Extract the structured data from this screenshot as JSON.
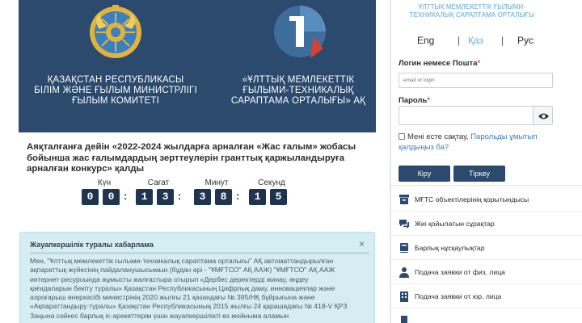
{
  "banner": {
    "org_left": [
      "ҚАЗАҚСТАН РЕСПУБЛИКАСЫ",
      "БІЛІМ ЖӘНЕ ҒЫЛЫМ МИНИСТРЛІГІ",
      "ҒЫЛЫМ КОМИТЕТІ"
    ],
    "org_right": [
      "«ҰЛТТЫҚ МЕМЛЕКЕТТІК",
      "ҒЫЛЫМИ-ТЕХНИКАЛЫҚ",
      "САРАПТАМА ОРТАЛЫҒЫ» АҚ"
    ]
  },
  "headline": "Аяқталғанға дейін «2022-2024 жылдарға арналған «Жас ғалым» жобасы бойынша жас ғалымдардың зерттеулерін гранттық қаржыландыруға арналған конкурс» қалды",
  "countdown": {
    "labels": [
      "Күн",
      "Сағат",
      "Минут",
      "Секунд"
    ],
    "days": [
      "0",
      "0"
    ],
    "hours": [
      "1",
      "3"
    ],
    "minutes": [
      "3",
      "8"
    ],
    "seconds": [
      "1",
      "5"
    ]
  },
  "notice": {
    "title": "Жауапкершілік туралы хабарлама",
    "close": "×",
    "lines": [
      "Мен, \"Ұлттық мемлекеттік ғылыми-техникалық сараптама орталығы\" АҚ автоматтандырылған",
      "ақпараттық жүйесінің пайдаланушысымын (бұдан әрі - \"ҰМҒТСО\" АҚ ААЖ) \"ҰМҒТСО\" АҚ ААЖ",
      "интернет-ресурсында жұмысты жалғастыра отырып «Дербес деректерді жинау, өңдеу",
      "қағидаларын бекіту туралы» Қазақстан Республикасының Цифрлық даму, инновациялар және",
      "аэроғарыш өнеркәсібі министрінің 2020 жылғы 21 қазандағы № 395/НҚ бұйрығына және",
      "«Ақпараттандыру туралы» Қазақстан Республикасының 2015 жылғы 24 қарашадағы № 418-V ҚРЗ",
      "Заңына сәйкес барлық іс-әрекеттерім үшін жауапкершілікті өз мойныма аламын"
    ]
  },
  "sidebar": {
    "title": [
      "ҰЛТТЫҚ МЕМЛЕКЕТТІК ҒЫЛЫМИ-",
      "ТЕХНИКАЛЫҚ САРАПТАМА ОРТАЛЫҒЫ"
    ],
    "langs": [
      "Eng",
      "Қаз",
      "Рус"
    ],
    "lang_sep": "|",
    "login_label": "Логин немесе Пошта",
    "login_placeholder": "email or login",
    "password_label": "Пароль",
    "required_mark": "*",
    "remember": "Мені есте сақтау,",
    "forgot": "Парольды ұмытып қалдыңыз ба?",
    "login_button": "Кіру",
    "register_button": "Тіркеу",
    "menu": [
      {
        "label": "МҒТС объектілерінің қорытындысы",
        "icon": "archive-icon"
      },
      {
        "label": "Жиі қойылатын сұрақтар",
        "icon": "chat-icon"
      },
      {
        "label": "Барлық нұсқаулықтар",
        "icon": "book-icon"
      },
      {
        "label": "Подача заявки от физ. лица",
        "icon": "user-icon"
      },
      {
        "label": "Подача заявки от юр. лица",
        "icon": "building-icon"
      }
    ]
  },
  "colors": {
    "brand": "#2b4a6d",
    "accent": "#5ea4d0",
    "notice_bg": "#d6edf2"
  }
}
